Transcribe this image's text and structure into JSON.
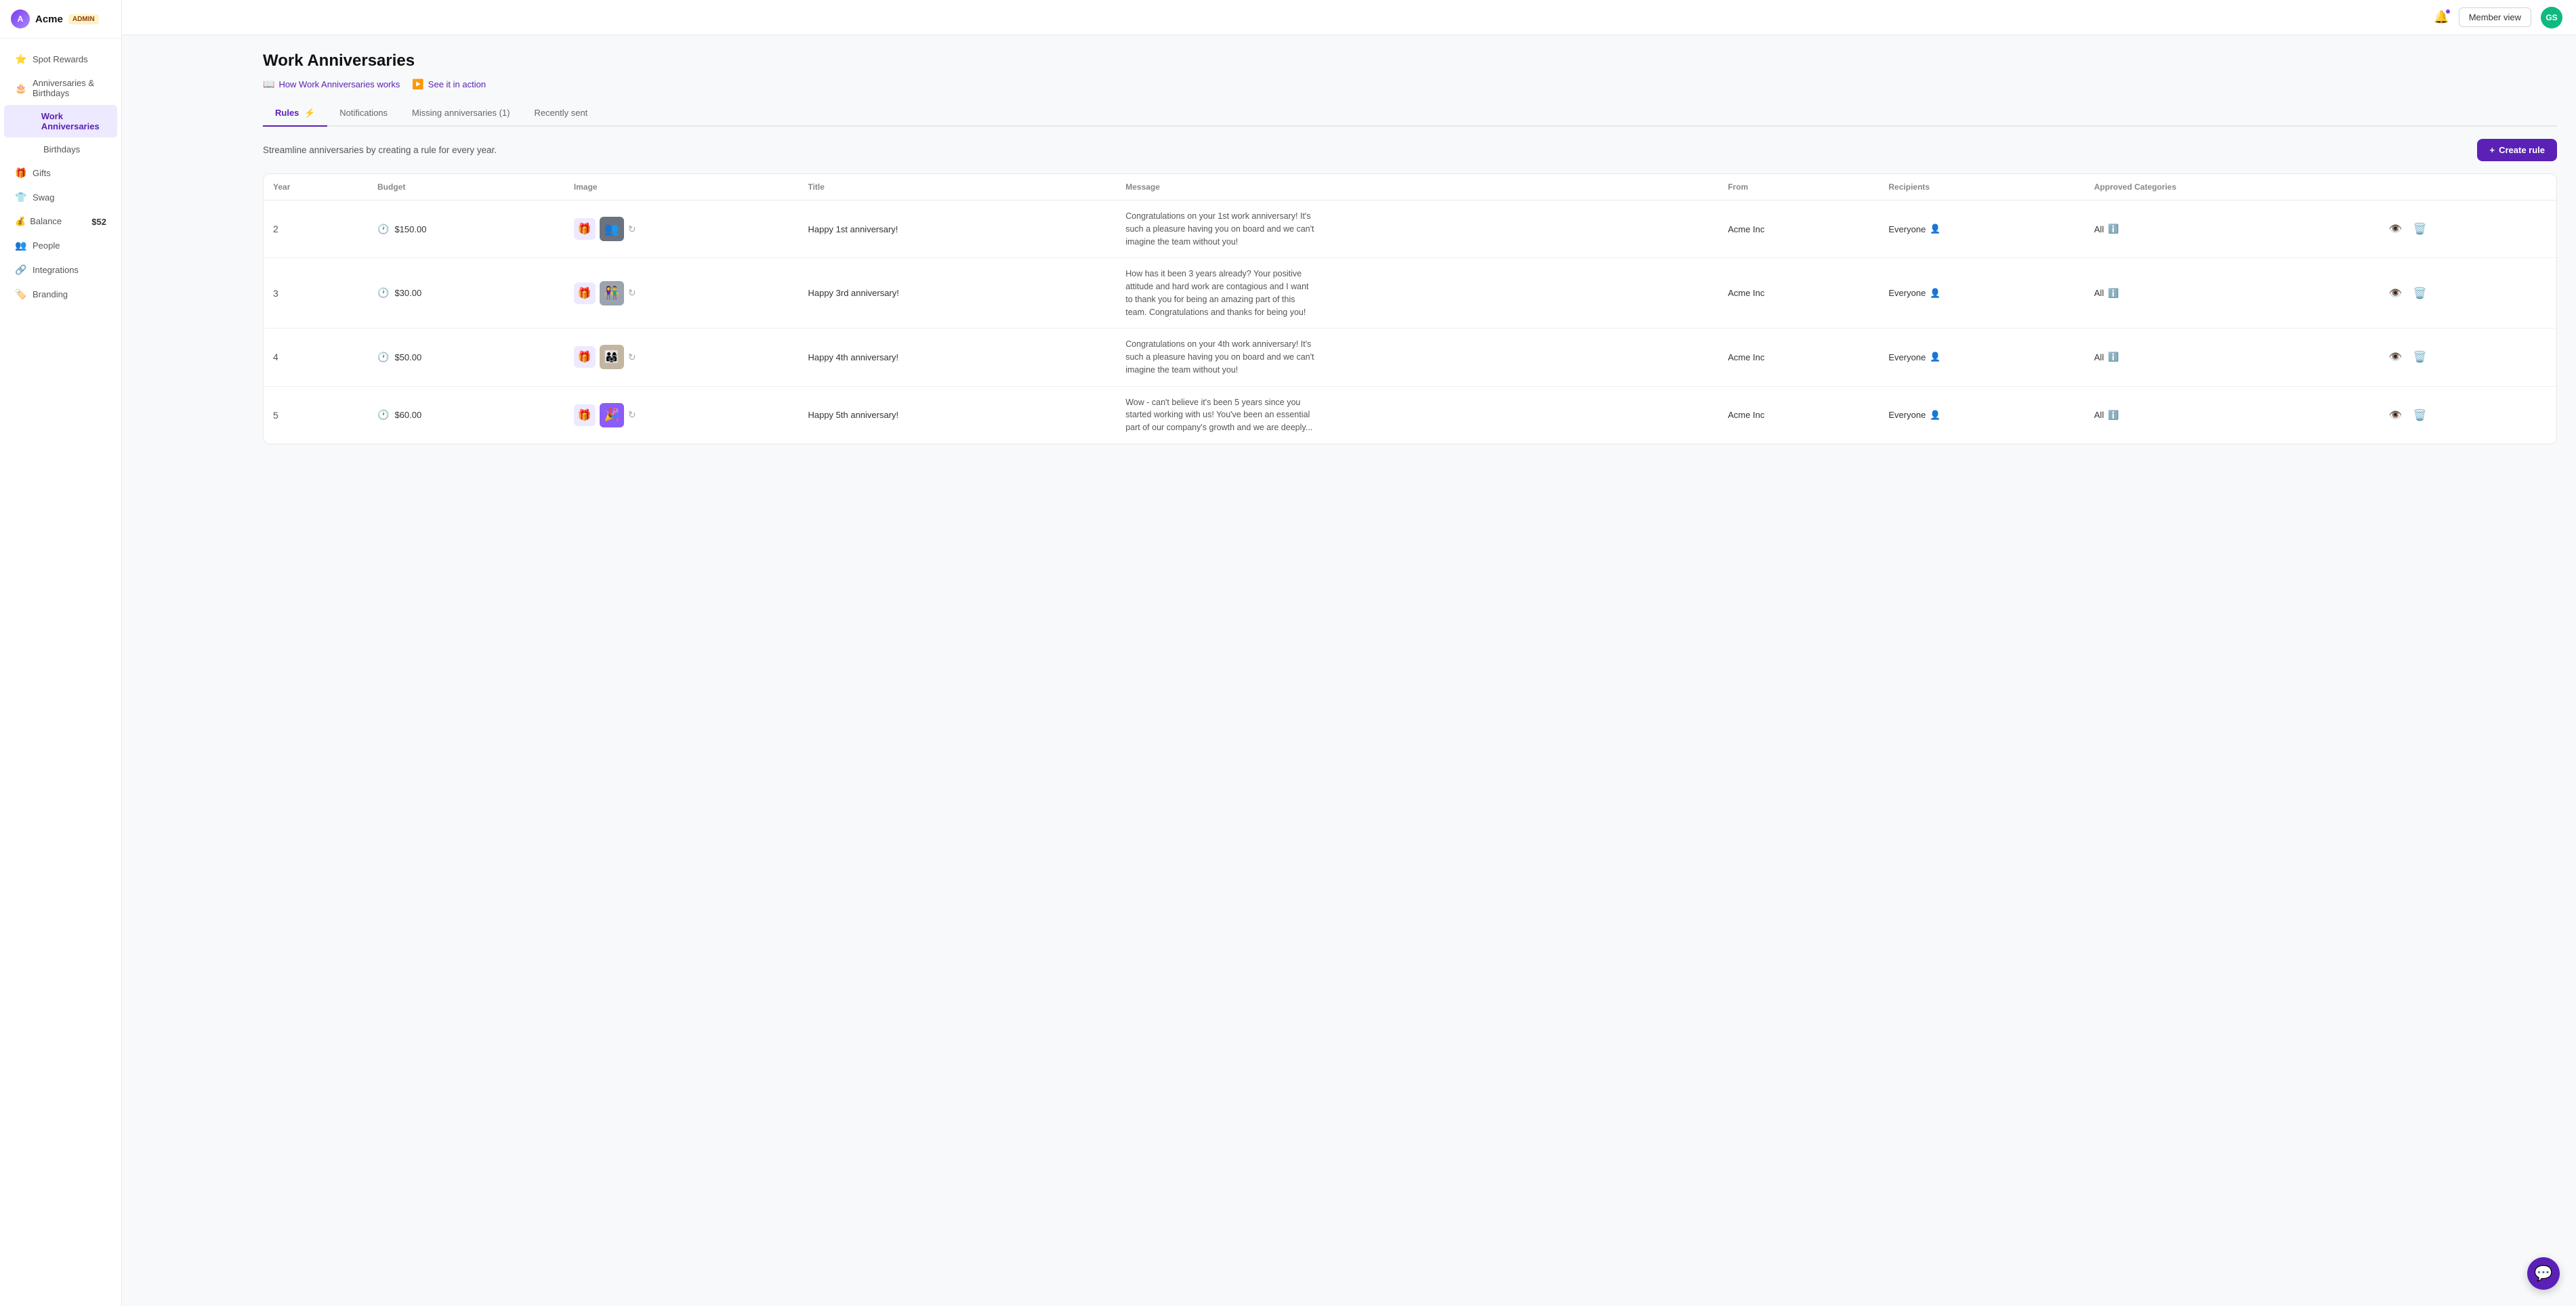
{
  "company": {
    "name": "Acme",
    "admin_badge": "ADMIN",
    "logo_text": "A"
  },
  "topbar": {
    "member_view_label": "Member view",
    "user_initials": "GS"
  },
  "sidebar": {
    "items": [
      {
        "id": "spot-rewards",
        "label": "Spot Rewards",
        "icon": "⭐"
      },
      {
        "id": "anniversaries-birthdays",
        "label": "Anniversaries & Birthdays",
        "icon": "🎂"
      },
      {
        "id": "work-anniversaries",
        "label": "Work Anniversaries",
        "icon": "",
        "sub": true,
        "active": true
      },
      {
        "id": "birthdays",
        "label": "Birthdays",
        "icon": "",
        "sub": true
      },
      {
        "id": "gifts",
        "label": "Gifts",
        "icon": "🎁"
      },
      {
        "id": "swag",
        "label": "Swag",
        "icon": "👕"
      },
      {
        "id": "balance",
        "label": "Balance",
        "icon": "💰",
        "value": "$52"
      },
      {
        "id": "people",
        "label": "People",
        "icon": "👥"
      },
      {
        "id": "integrations",
        "label": "Integrations",
        "icon": "🔗"
      },
      {
        "id": "branding",
        "label": "Branding",
        "icon": "🏷️"
      }
    ]
  },
  "page": {
    "title": "Work Anniversaries",
    "help_links": [
      {
        "id": "how-works",
        "label": "How Work Anniversaries works",
        "icon": "📖"
      },
      {
        "id": "see-action",
        "label": "See it in action",
        "icon": "▶️"
      }
    ],
    "tabs": [
      {
        "id": "rules",
        "label": "Rules",
        "active": true,
        "emoji": "⚡"
      },
      {
        "id": "notifications",
        "label": "Notifications"
      },
      {
        "id": "missing",
        "label": "Missing anniversaries (1)",
        "badge": "1"
      },
      {
        "id": "recently-sent",
        "label": "Recently sent"
      }
    ],
    "subtitle": "Streamline anniversaries by creating a rule for every year.",
    "create_rule_label": "Create rule"
  },
  "table": {
    "headers": [
      "Year",
      "Budget",
      "Image",
      "Title",
      "Message",
      "From",
      "Recipients",
      "Approved Categories"
    ],
    "rows": [
      {
        "year": 2,
        "budget": "$150.00",
        "title": "Happy 1st anniversary!",
        "message": "Congratulations on your 1st work anniversary! It's such a pleasure having you on board and we can't imagine the team without you!",
        "from": "Acme Inc",
        "recipients": "Everyone",
        "categories": "All",
        "thumb_emoji": "👥",
        "thumb_class": "thumb-1"
      },
      {
        "year": 3,
        "budget": "$30.00",
        "title": "Happy 3rd anniversary!",
        "message": "How has it been 3 years already? Your positive attitude and hard work are contagious and I want to thank you for being an amazing part of this team. Congratulations and thanks for being you!",
        "from": "Acme Inc",
        "recipients": "Everyone",
        "categories": "All",
        "thumb_emoji": "👫",
        "thumb_class": "thumb-2"
      },
      {
        "year": 4,
        "budget": "$50.00",
        "title": "Happy 4th anniversary!",
        "message": "Congratulations on your 4th work anniversary! It's such a pleasure having you on board and we can't imagine the team without you!",
        "from": "Acme Inc",
        "recipients": "Everyone",
        "categories": "All",
        "thumb_emoji": "👨‍👩‍👧",
        "thumb_class": "thumb-3"
      },
      {
        "year": 5,
        "budget": "$60.00",
        "title": "Happy 5th anniversary!",
        "message": "Wow - can't believe it's been 5 years since you started working with us! You've been an essential part of our company's growth and we are deeply...",
        "from": "Acme Inc",
        "recipients": "Everyone",
        "categories": "All",
        "thumb_emoji": "🎉",
        "thumb_class": "thumb-4"
      }
    ]
  }
}
